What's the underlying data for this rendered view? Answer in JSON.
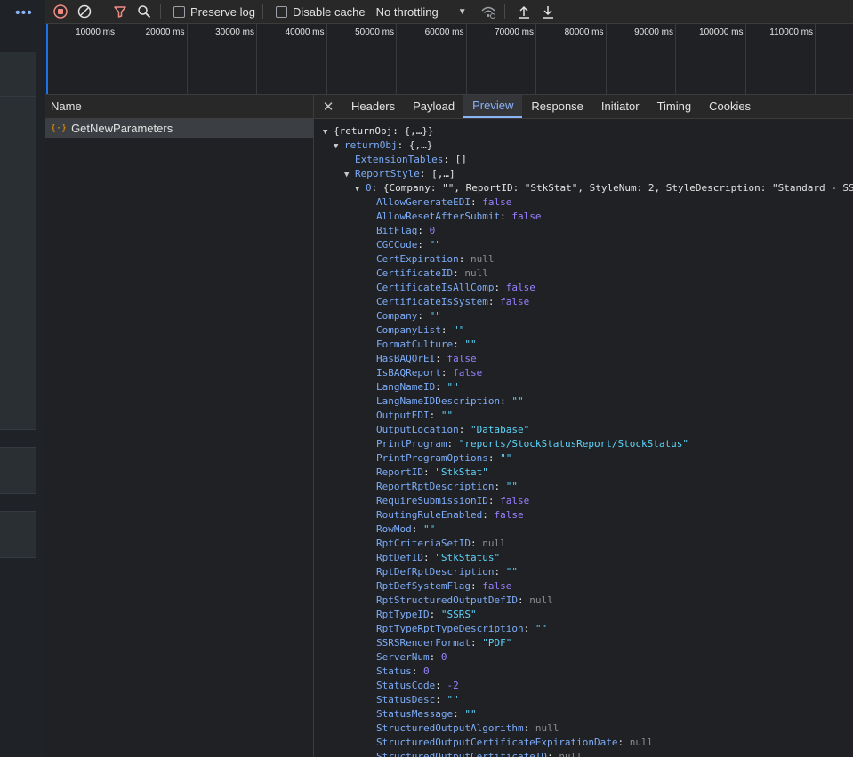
{
  "toolbar": {
    "more_label": "•••",
    "preserve_log": "Preserve log",
    "disable_cache": "Disable cache",
    "throttling": "No throttling"
  },
  "overview": {
    "ticks": [
      "10000 ms",
      "20000 ms",
      "30000 ms",
      "40000 ms",
      "50000 ms",
      "60000 ms",
      "70000 ms",
      "80000 ms",
      "90000 ms",
      "100000 ms",
      "110000 ms",
      "12"
    ]
  },
  "name_column": {
    "header": "Name",
    "request": "GetNewParameters"
  },
  "tabs": [
    "Headers",
    "Payload",
    "Preview",
    "Response",
    "Initiator",
    "Timing",
    "Cookies"
  ],
  "active_tab": "Preview",
  "preview": {
    "lines": [
      {
        "indent": 0,
        "toggle": "open",
        "parts": [
          [
            "p",
            "{returnObj: {,…}}"
          ]
        ]
      },
      {
        "indent": 1,
        "toggle": "open",
        "parts": [
          [
            "k",
            "returnObj"
          ],
          [
            "p",
            ": {,…}"
          ]
        ]
      },
      {
        "indent": 2,
        "toggle": "",
        "parts": [
          [
            "k",
            "ExtensionTables"
          ],
          [
            "p",
            ": []"
          ]
        ]
      },
      {
        "indent": 2,
        "toggle": "open",
        "parts": [
          [
            "k",
            "ReportStyle"
          ],
          [
            "p",
            ": [,…]"
          ]
        ]
      },
      {
        "indent": 3,
        "toggle": "open",
        "parts": [
          [
            "k",
            "0"
          ],
          [
            "p",
            ": {Company: \"\", ReportID: \"StkStat\", StyleNum: 2, StyleDescription: \"Standard - SS"
          ]
        ]
      },
      {
        "indent": 4,
        "toggle": "",
        "parts": [
          [
            "k",
            "AllowGenerateEDI"
          ],
          [
            "p",
            ": "
          ],
          [
            "bool",
            "false"
          ]
        ]
      },
      {
        "indent": 4,
        "toggle": "",
        "parts": [
          [
            "k",
            "AllowResetAfterSubmit"
          ],
          [
            "p",
            ": "
          ],
          [
            "bool",
            "false"
          ]
        ]
      },
      {
        "indent": 4,
        "toggle": "",
        "parts": [
          [
            "k",
            "BitFlag"
          ],
          [
            "p",
            ": "
          ],
          [
            "num",
            "0"
          ]
        ]
      },
      {
        "indent": 4,
        "toggle": "",
        "parts": [
          [
            "k",
            "CGCCode"
          ],
          [
            "p",
            ": "
          ],
          [
            "str",
            "\"\""
          ]
        ]
      },
      {
        "indent": 4,
        "toggle": "",
        "parts": [
          [
            "k",
            "CertExpiration"
          ],
          [
            "p",
            ": "
          ],
          [
            "nul",
            "null"
          ]
        ]
      },
      {
        "indent": 4,
        "toggle": "",
        "parts": [
          [
            "k",
            "CertificateID"
          ],
          [
            "p",
            ": "
          ],
          [
            "nul",
            "null"
          ]
        ]
      },
      {
        "indent": 4,
        "toggle": "",
        "parts": [
          [
            "k",
            "CertificateIsAllComp"
          ],
          [
            "p",
            ": "
          ],
          [
            "bool",
            "false"
          ]
        ]
      },
      {
        "indent": 4,
        "toggle": "",
        "parts": [
          [
            "k",
            "CertificateIsSystem"
          ],
          [
            "p",
            ": "
          ],
          [
            "bool",
            "false"
          ]
        ]
      },
      {
        "indent": 4,
        "toggle": "",
        "parts": [
          [
            "k",
            "Company"
          ],
          [
            "p",
            ": "
          ],
          [
            "str",
            "\"\""
          ]
        ]
      },
      {
        "indent": 4,
        "toggle": "",
        "parts": [
          [
            "k",
            "CompanyList"
          ],
          [
            "p",
            ": "
          ],
          [
            "str",
            "\"\""
          ]
        ]
      },
      {
        "indent": 4,
        "toggle": "",
        "parts": [
          [
            "k",
            "FormatCulture"
          ],
          [
            "p",
            ": "
          ],
          [
            "str",
            "\"\""
          ]
        ]
      },
      {
        "indent": 4,
        "toggle": "",
        "parts": [
          [
            "k",
            "HasBAQOrEI"
          ],
          [
            "p",
            ": "
          ],
          [
            "bool",
            "false"
          ]
        ]
      },
      {
        "indent": 4,
        "toggle": "",
        "parts": [
          [
            "k",
            "IsBAQReport"
          ],
          [
            "p",
            ": "
          ],
          [
            "bool",
            "false"
          ]
        ]
      },
      {
        "indent": 4,
        "toggle": "",
        "parts": [
          [
            "k",
            "LangNameID"
          ],
          [
            "p",
            ": "
          ],
          [
            "str",
            "\"\""
          ]
        ]
      },
      {
        "indent": 4,
        "toggle": "",
        "parts": [
          [
            "k",
            "LangNameIDDescription"
          ],
          [
            "p",
            ": "
          ],
          [
            "str",
            "\"\""
          ]
        ]
      },
      {
        "indent": 4,
        "toggle": "",
        "parts": [
          [
            "k",
            "OutputEDI"
          ],
          [
            "p",
            ": "
          ],
          [
            "str",
            "\"\""
          ]
        ]
      },
      {
        "indent": 4,
        "toggle": "",
        "parts": [
          [
            "k",
            "OutputLocation"
          ],
          [
            "p",
            ": "
          ],
          [
            "str",
            "\"Database\""
          ]
        ]
      },
      {
        "indent": 4,
        "toggle": "",
        "parts": [
          [
            "k",
            "PrintProgram"
          ],
          [
            "p",
            ": "
          ],
          [
            "str",
            "\"reports/StockStatusReport/StockStatus\""
          ]
        ]
      },
      {
        "indent": 4,
        "toggle": "",
        "parts": [
          [
            "k",
            "PrintProgramOptions"
          ],
          [
            "p",
            ": "
          ],
          [
            "str",
            "\"\""
          ]
        ]
      },
      {
        "indent": 4,
        "toggle": "",
        "parts": [
          [
            "k",
            "ReportID"
          ],
          [
            "p",
            ": "
          ],
          [
            "str",
            "\"StkStat\""
          ]
        ]
      },
      {
        "indent": 4,
        "toggle": "",
        "parts": [
          [
            "k",
            "ReportRptDescription"
          ],
          [
            "p",
            ": "
          ],
          [
            "str",
            "\"\""
          ]
        ]
      },
      {
        "indent": 4,
        "toggle": "",
        "parts": [
          [
            "k",
            "RequireSubmissionID"
          ],
          [
            "p",
            ": "
          ],
          [
            "bool",
            "false"
          ]
        ]
      },
      {
        "indent": 4,
        "toggle": "",
        "parts": [
          [
            "k",
            "RoutingRuleEnabled"
          ],
          [
            "p",
            ": "
          ],
          [
            "bool",
            "false"
          ]
        ]
      },
      {
        "indent": 4,
        "toggle": "",
        "parts": [
          [
            "k",
            "RowMod"
          ],
          [
            "p",
            ": "
          ],
          [
            "str",
            "\"\""
          ]
        ]
      },
      {
        "indent": 4,
        "toggle": "",
        "parts": [
          [
            "k",
            "RptCriteriaSetID"
          ],
          [
            "p",
            ": "
          ],
          [
            "nul",
            "null"
          ]
        ]
      },
      {
        "indent": 4,
        "toggle": "",
        "parts": [
          [
            "k",
            "RptDefID"
          ],
          [
            "p",
            ": "
          ],
          [
            "str",
            "\"StkStatus\""
          ]
        ]
      },
      {
        "indent": 4,
        "toggle": "",
        "parts": [
          [
            "k",
            "RptDefRptDescription"
          ],
          [
            "p",
            ": "
          ],
          [
            "str",
            "\"\""
          ]
        ]
      },
      {
        "indent": 4,
        "toggle": "",
        "parts": [
          [
            "k",
            "RptDefSystemFlag"
          ],
          [
            "p",
            ": "
          ],
          [
            "bool",
            "false"
          ]
        ]
      },
      {
        "indent": 4,
        "toggle": "",
        "parts": [
          [
            "k",
            "RptStructuredOutputDefID"
          ],
          [
            "p",
            ": "
          ],
          [
            "nul",
            "null"
          ]
        ]
      },
      {
        "indent": 4,
        "toggle": "",
        "parts": [
          [
            "k",
            "RptTypeID"
          ],
          [
            "p",
            ": "
          ],
          [
            "str",
            "\"SSRS\""
          ]
        ]
      },
      {
        "indent": 4,
        "toggle": "",
        "parts": [
          [
            "k",
            "RptTypeRptTypeDescription"
          ],
          [
            "p",
            ": "
          ],
          [
            "str",
            "\"\""
          ]
        ]
      },
      {
        "indent": 4,
        "toggle": "",
        "parts": [
          [
            "k",
            "SSRSRenderFormat"
          ],
          [
            "p",
            ": "
          ],
          [
            "str",
            "\"PDF\""
          ]
        ]
      },
      {
        "indent": 4,
        "toggle": "",
        "parts": [
          [
            "k",
            "ServerNum"
          ],
          [
            "p",
            ": "
          ],
          [
            "num",
            "0"
          ]
        ]
      },
      {
        "indent": 4,
        "toggle": "",
        "parts": [
          [
            "k",
            "Status"
          ],
          [
            "p",
            ": "
          ],
          [
            "num",
            "0"
          ]
        ]
      },
      {
        "indent": 4,
        "toggle": "",
        "parts": [
          [
            "k",
            "StatusCode"
          ],
          [
            "p",
            ": "
          ],
          [
            "num",
            "-2"
          ]
        ]
      },
      {
        "indent": 4,
        "toggle": "",
        "parts": [
          [
            "k",
            "StatusDesc"
          ],
          [
            "p",
            ": "
          ],
          [
            "str",
            "\"\""
          ]
        ]
      },
      {
        "indent": 4,
        "toggle": "",
        "parts": [
          [
            "k",
            "StatusMessage"
          ],
          [
            "p",
            ": "
          ],
          [
            "str",
            "\"\""
          ]
        ]
      },
      {
        "indent": 4,
        "toggle": "",
        "parts": [
          [
            "k",
            "StructuredOutputAlgorithm"
          ],
          [
            "p",
            ": "
          ],
          [
            "nul",
            "null"
          ]
        ]
      },
      {
        "indent": 4,
        "toggle": "",
        "parts": [
          [
            "k",
            "StructuredOutputCertificateExpirationDate"
          ],
          [
            "p",
            ": "
          ],
          [
            "nul",
            "null"
          ]
        ]
      },
      {
        "indent": 4,
        "toggle": "",
        "parts": [
          [
            "k",
            "StructuredOutputCertificateID"
          ],
          [
            "p",
            ": "
          ],
          [
            "nul",
            "null"
          ]
        ]
      }
    ]
  },
  "colors": {
    "accent": "#8ab4f8",
    "record_red": "#f28b82",
    "filter_red": "#f28b82",
    "key": "#7cacf8",
    "string": "#5cd5fb",
    "boolean": "#9980ff",
    "null": "#8d8d8d"
  },
  "icons": [
    "more-icon",
    "stop-record-icon",
    "clear-icon",
    "filter-icon",
    "search-icon",
    "wifi-conditions-icon",
    "import-icon",
    "export-icon",
    "close-icon",
    "expand-triangle-icon",
    "json-icon"
  ]
}
